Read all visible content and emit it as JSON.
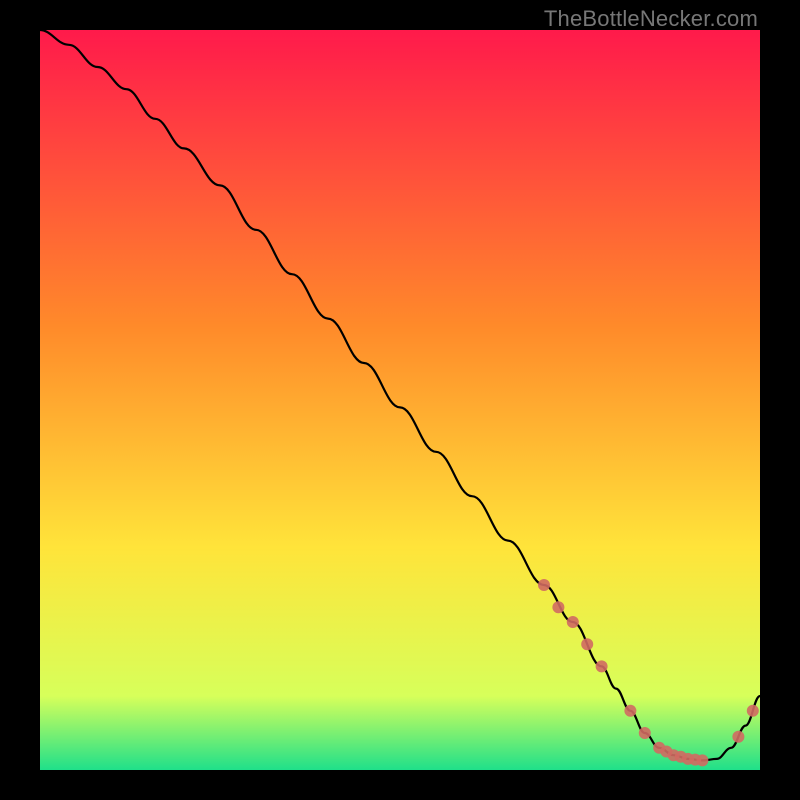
{
  "watermark": "TheBottleNecker.com",
  "colors": {
    "gradient_top": "#ff1a4b",
    "gradient_mid1": "#ff8a2a",
    "gradient_mid2": "#ffe43a",
    "gradient_mid3": "#d7ff5a",
    "gradient_bottom": "#1fe08a",
    "curve": "#000000",
    "marker": "#d06a62",
    "frame_bg": "#000000"
  },
  "chart_data": {
    "type": "line",
    "title": "",
    "xlabel": "",
    "ylabel": "",
    "xlim": [
      0,
      100
    ],
    "ylim": [
      0,
      100
    ],
    "series": [
      {
        "name": "bottleneck-curve",
        "x": [
          0,
          4,
          8,
          12,
          16,
          20,
          25,
          30,
          35,
          40,
          45,
          50,
          55,
          60,
          65,
          70,
          74,
          78,
          80,
          82,
          84,
          86,
          88,
          90,
          92,
          94,
          96,
          98,
          100
        ],
        "y": [
          100,
          98,
          95,
          92,
          88,
          84,
          79,
          73,
          67,
          61,
          55,
          49,
          43,
          37,
          31,
          25,
          20,
          14,
          11,
          8,
          5,
          3,
          2,
          1.5,
          1.3,
          1.5,
          3,
          6,
          10
        ]
      }
    ],
    "markers": {
      "name": "highlight-points",
      "x": [
        70,
        72,
        74,
        76,
        78,
        82,
        84,
        86,
        87,
        88,
        89,
        90,
        91,
        92,
        97,
        99
      ],
      "y": [
        25,
        22,
        20,
        17,
        14,
        8,
        5,
        3,
        2.5,
        2,
        1.8,
        1.5,
        1.4,
        1.3,
        4.5,
        8
      ]
    }
  }
}
